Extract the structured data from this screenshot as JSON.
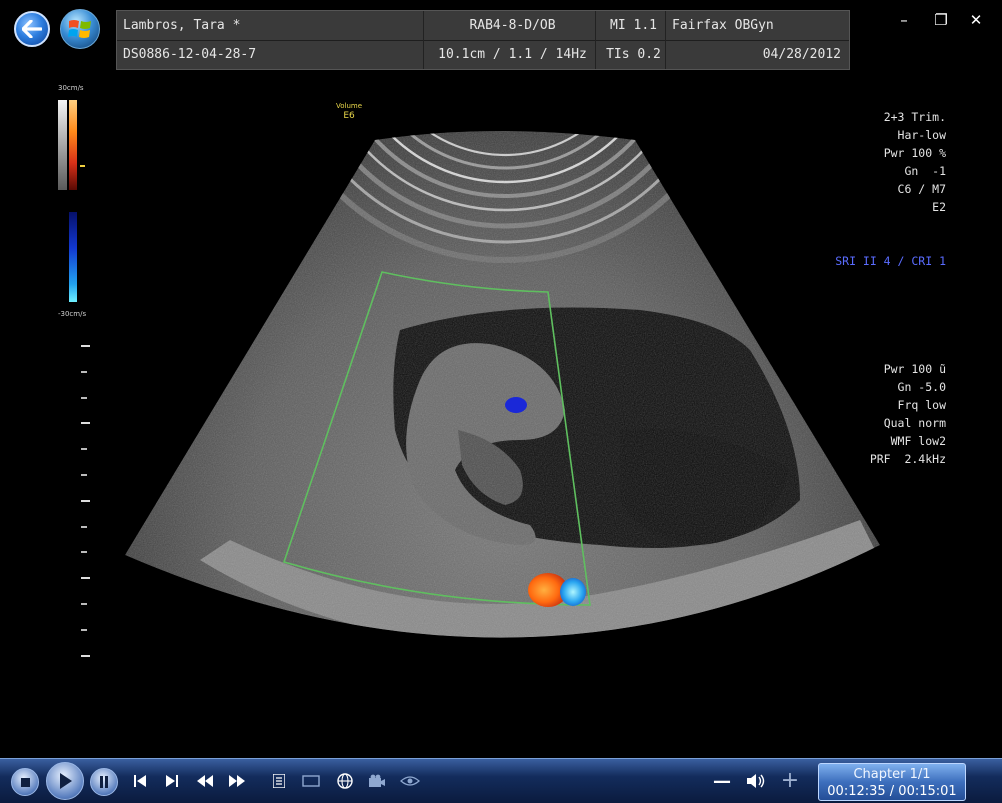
{
  "window": {
    "minimize_glyph": "–",
    "maximize_glyph": "❐",
    "close_glyph": "✕"
  },
  "patient_header": {
    "row1": {
      "patient_name": "Lambros, Tara *",
      "probe_preset": "RAB4-8-D/OB",
      "mi": "MI  1.1",
      "institution": "Fairfax OBGyn"
    },
    "row2": {
      "exam_id": "DS0886-12-04-28-7",
      "depth_freq": "10.1cm / 1.1 / 14Hz",
      "tis": "TIs  0.2",
      "date": "04/28/2012"
    }
  },
  "color_scale": {
    "top_label": "30cm/s",
    "bottom_label": "-30cm/s"
  },
  "volume": {
    "label": "Volume",
    "value": "E6"
  },
  "parameters": {
    "block1": [
      "2+3 Trim.",
      "Har-low",
      "Pwr 100 %",
      "Gn  -1",
      "C6 / M7",
      "E2"
    ],
    "sri_line": "SRI II 4 / CRI 1",
    "block2": [
      "Pwr 100 ũ",
      "Gn -5.0",
      "Frq low",
      "Qual norm",
      "WMF low2",
      "PRF  2.4kHz"
    ]
  },
  "player": {
    "buttons": [
      "stop",
      "play",
      "pause",
      "previous",
      "next",
      "rewind",
      "fast-forward",
      "playlist",
      "screen",
      "globe",
      "camera",
      "visualization"
    ],
    "volume_minus": "—",
    "volume_plus": "+",
    "chapter": "Chapter 1/1",
    "time": "00:12:35 / 00:15:01"
  },
  "colors": {
    "chrome_blue": "#1c3f7a",
    "roi_box": "#5fbf5f",
    "doppler_red": "#ff6a10",
    "doppler_blue": "#2aa6f0",
    "sri_text": "#5a6cff"
  }
}
